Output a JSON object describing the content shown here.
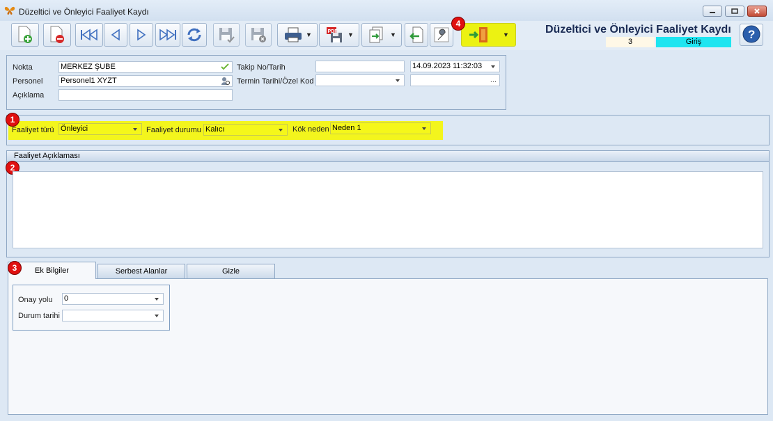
{
  "window": {
    "title": "Düzeltici ve Önleyici Faaliyet Kaydı",
    "icon": "butterfly-icon",
    "controls": [
      "minimize-icon",
      "maximize-icon",
      "close-icon"
    ]
  },
  "toolbar": {
    "buttons": [
      "add-record-icon",
      "delete-record-icon",
      "first-record-icon",
      "previous-record-icon",
      "next-record-icon",
      "last-record-icon",
      "refresh-icon",
      "save-icon",
      "cancel-save-icon",
      "print-icon",
      "pdf-export-icon",
      "export-icon",
      "import-icon",
      "settings-wrench-icon",
      "exit-door-icon"
    ]
  },
  "header": {
    "form_title": "Düzeltici ve Önleyici Faaliyet Kaydı",
    "record_count": "3",
    "mode": "Giriş"
  },
  "annotations": {
    "b1": "1",
    "b2": "2",
    "b3": "3",
    "b4": "4"
  },
  "info": {
    "nokta_label": "Nokta",
    "nokta_value": "MERKEZ ŞUBE",
    "personel_label": "Personel",
    "personel_value": "Personel1 XYZT",
    "aciklama_label": "Açıklama",
    "aciklama_value": "",
    "takip_label": "Takip No/Tarih",
    "takip_value": "",
    "takip_date": "14.09.2023 11:32:03",
    "termin_label": "Termin Tarihi/Özel Kod",
    "termin_value": "",
    "ozel_kod_value": "..."
  },
  "activity": {
    "type_label": "Faaliyet türü",
    "type_value": "Önleyici",
    "status_label": "Faaliyet durumu",
    "status_value": "Kalıcı",
    "root_label": "Kök neden",
    "root_value": "Neden 1"
  },
  "description": {
    "header": "Faaliyet Açıklaması",
    "value": ""
  },
  "tabs": [
    {
      "label": "Ek Bilgiler"
    },
    {
      "label": "Serbest Alanlar"
    },
    {
      "label": "Gizle"
    }
  ],
  "ek_bilgiler": {
    "onay_label": "Onay yolu",
    "onay_value": "0",
    "durum_label": "Durum tarihi",
    "durum_value": ""
  },
  "colors": {
    "highlight": "#f3f51d",
    "mode_bg": "#1fe5f0",
    "badge": "#e01010",
    "title": "#1a2b54"
  }
}
